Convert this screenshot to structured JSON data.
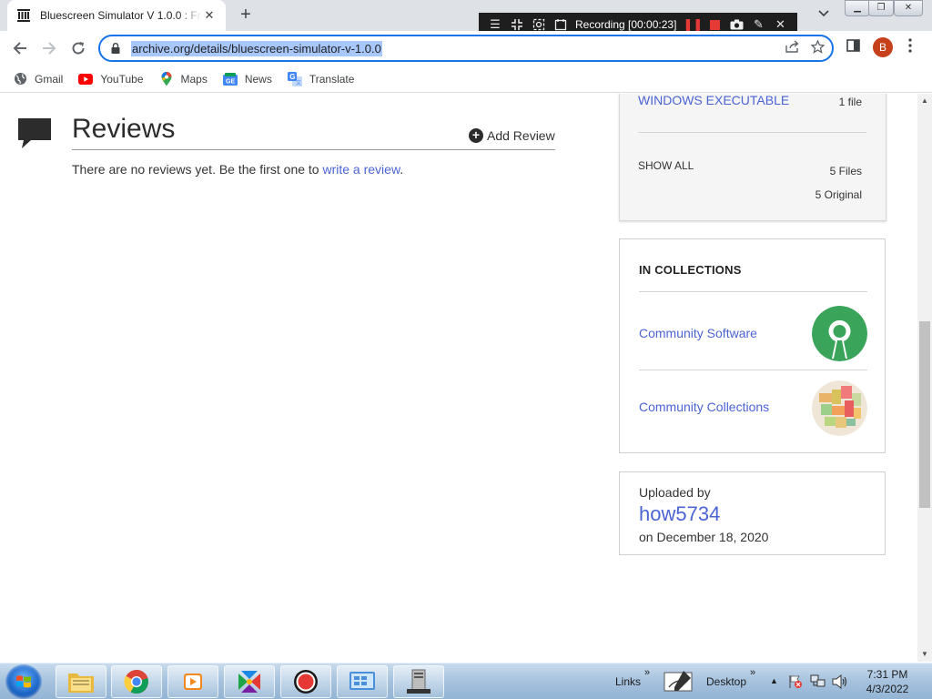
{
  "browser": {
    "tab_title": "Bluescreen Simulator V 1.0.0 : Free",
    "new_tab": "+",
    "tab_close": "✕",
    "url": "archive.org/details/bluescreen-simulator-v-1.0.0",
    "profile_initial": "B",
    "bookmarks": [
      {
        "label": "Gmail",
        "icon": "globe-icon"
      },
      {
        "label": "YouTube",
        "icon": "youtube-icon"
      },
      {
        "label": "Maps",
        "icon": "maps-icon"
      },
      {
        "label": "News",
        "icon": "news-icon"
      },
      {
        "label": "Translate",
        "icon": "translate-icon"
      }
    ]
  },
  "recorder": {
    "status": "Recording [00:00:23]"
  },
  "reviews": {
    "title": "Reviews",
    "add_label": "Add Review",
    "empty_text": "There are no reviews yet. Be the first one to",
    "empty_link": "write a review",
    "empty_end": "."
  },
  "files": {
    "executable_label": "WINDOWS EXECUTABLE",
    "executable_count": "1 file",
    "show_all": "SHOW ALL",
    "total_files": "5 Files",
    "original_files": "5 Original"
  },
  "collections": {
    "title": "IN COLLECTIONS",
    "items": [
      {
        "label": "Community Software"
      },
      {
        "label": "Community Collections"
      }
    ]
  },
  "uploader": {
    "label": "Uploaded by",
    "user": "how5734",
    "date": "on December 18, 2020"
  },
  "taskbar": {
    "links": "Links",
    "desktop": "Desktop",
    "time": "7:31 PM",
    "date": "4/3/2022"
  },
  "colors": {
    "link": "#4b64d4",
    "omnibox_focus": "#1a73e8",
    "url_selection": "#a8c7fa",
    "avatar": "#c5401b",
    "record_red": "#e53935"
  }
}
